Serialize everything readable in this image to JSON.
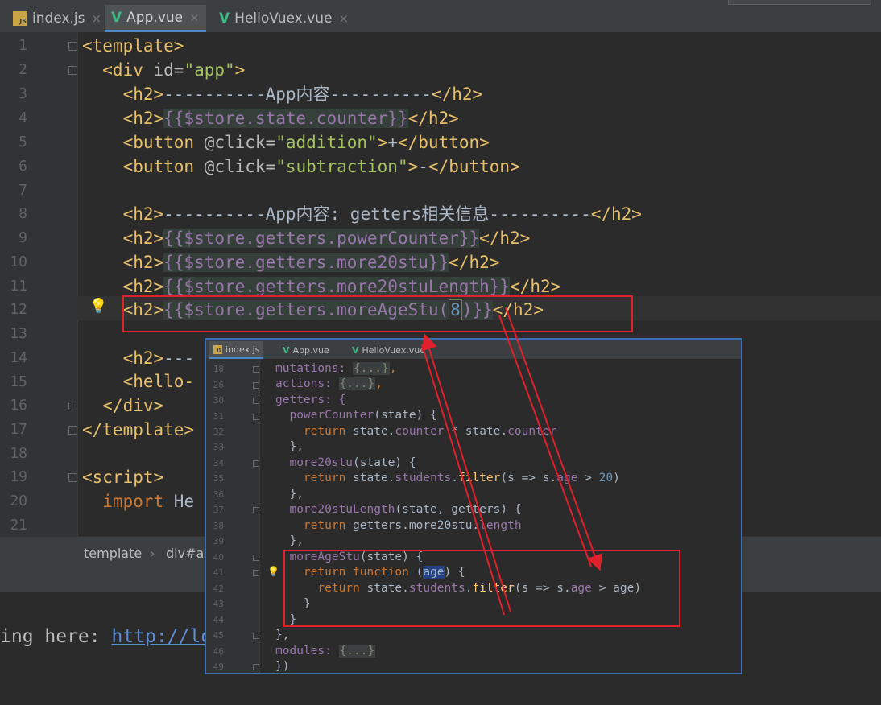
{
  "main_tabs": [
    {
      "label": "index.js",
      "icon": "js-file-icon",
      "active": false
    },
    {
      "label": "App.vue",
      "icon": "vue-file-icon",
      "active": true
    },
    {
      "label": "HelloVuex.vue",
      "icon": "vue-file-icon",
      "active": false
    }
  ],
  "tab_close_glyph": "×",
  "line_numbers": [
    "1",
    "2",
    "3",
    "4",
    "5",
    "6",
    "7",
    "8",
    "9",
    "10",
    "11",
    "12",
    "13",
    "14",
    "15",
    "16",
    "17",
    "18",
    "19",
    "20",
    "21"
  ],
  "code": {
    "l1": "<template>",
    "l2_a": "  <div ",
    "l2_b": "id=",
    "l2_c": "\"app\"",
    "l2_d": ">",
    "l3_a": "    <h2>",
    "l3_b": "----------App内容----------",
    "l3_c": "</h2>",
    "l4_a": "    <h2>",
    "l4_b": "{{$store.state.counter}}",
    "l4_c": "</h2>",
    "l5_a": "    <button ",
    "l5_b": "@click=",
    "l5_c": "\"addition\"",
    "l5_d": ">",
    "l5_e": "+",
    "l5_f": "</button>",
    "l6_a": "    <button ",
    "l6_b": "@click=",
    "l6_c": "\"subtraction\"",
    "l6_d": ">",
    "l6_e": "-",
    "l6_f": "</button>",
    "l8_a": "    <h2>",
    "l8_b": "----------App内容: getters相关信息----------",
    "l8_c": "</h2>",
    "l9_a": "    <h2>",
    "l9_b": "{{$store.getters.powerCounter}}",
    "l9_c": "</h2>",
    "l10_a": "    <h2>",
    "l10_b": "{{$store.getters.more20stu}}",
    "l10_c": "</h2>",
    "l11_a": "    <h2>",
    "l11_b": "{{$store.getters.more20stuLength}}",
    "l11_c": "</h2>",
    "l12_a": "    <h2>",
    "l12_b": "{{$store.getters.moreAgeStu(",
    "l12_c": "8",
    "l12_d": ")}}",
    "l12_e": "</h2>",
    "l14_a": "    <h2>",
    "l14_b": "---",
    "l15_a": "    <hello-",
    "l16": "  </div>",
    "l17": "</template>",
    "l19": "<script>",
    "l20_a": "  import ",
    "l20_b": "He"
  },
  "breadcrumb": [
    "template",
    "div#ap"
  ],
  "breadcrumb_sep": "›",
  "terminal": {
    "prefix": "ing here: ",
    "link": "http://lo"
  },
  "inset": {
    "tabs": [
      {
        "label": "index.js",
        "active": true
      },
      {
        "label": "App.vue",
        "active": false
      },
      {
        "label": "HelloVuex.vue",
        "active": false
      }
    ],
    "line_numbers": [
      "18",
      "26",
      "30",
      "31",
      "32",
      "33",
      "34",
      "35",
      "36",
      "37",
      "38",
      "39",
      "40",
      "41",
      "42",
      "43",
      "44",
      "45",
      "46",
      "49"
    ],
    "lines": {
      "l18_a": "mutations: ",
      "l18_b": "{...}",
      "l18_c": ",",
      "l26_a": "actions: ",
      "l26_b": "{...}",
      "l26_c": ",",
      "l30": "getters: {",
      "l31_a": "  powerCounter",
      "l31_b": "(state) {",
      "l32_a": "    return ",
      "l32_b": "state.",
      "l32_c": "counter",
      "l32_d": " * ",
      "l32_e": "state.",
      "l32_f": "counter",
      "l33": "  },",
      "l34_a": "  more20stu",
      "l34_b": "(state) {",
      "l35_a": "    return ",
      "l35_b": "state.",
      "l35_c": "students",
      "l35_d": ".",
      "l35_e": "filter",
      "l35_f": "(s => s.",
      "l35_g": "age",
      "l35_h": " > ",
      "l35_i": "20",
      "l35_j": ")",
      "l36": "  },",
      "l37_a": "  more20stuLength",
      "l37_b": "(state, getters) {",
      "l38_a": "    return ",
      "l38_b": "getters.more20stu.",
      "l38_c": "length",
      "l39": "  },",
      "l40_a": "  moreAgeStu",
      "l40_b": "(state) {",
      "l41_a": "    return ",
      "l41_b": "function ",
      "l41_c": "(",
      "l41_d": "age",
      "l41_e": ") {",
      "l42_a": "      return ",
      "l42_b": "state.",
      "l42_c": "students",
      "l42_d": ".",
      "l42_e": "filter",
      "l42_f": "(s => s.",
      "l42_g": "age",
      "l42_h": " > ",
      "l42_i": "age",
      "l42_j": ")",
      "l43": "    }",
      "l44": "  }",
      "l45": "},",
      "l46_a": "modules: ",
      "l46_b": "{...}",
      "l49": "})"
    }
  },
  "colors": {
    "annotation_red": "#e0202a",
    "inset_border": "#3d6fb5"
  },
  "icons": [
    "js-file-icon",
    "vue-file-icon",
    "close-icon",
    "lightbulb-icon",
    "fold-marker-icon"
  ]
}
